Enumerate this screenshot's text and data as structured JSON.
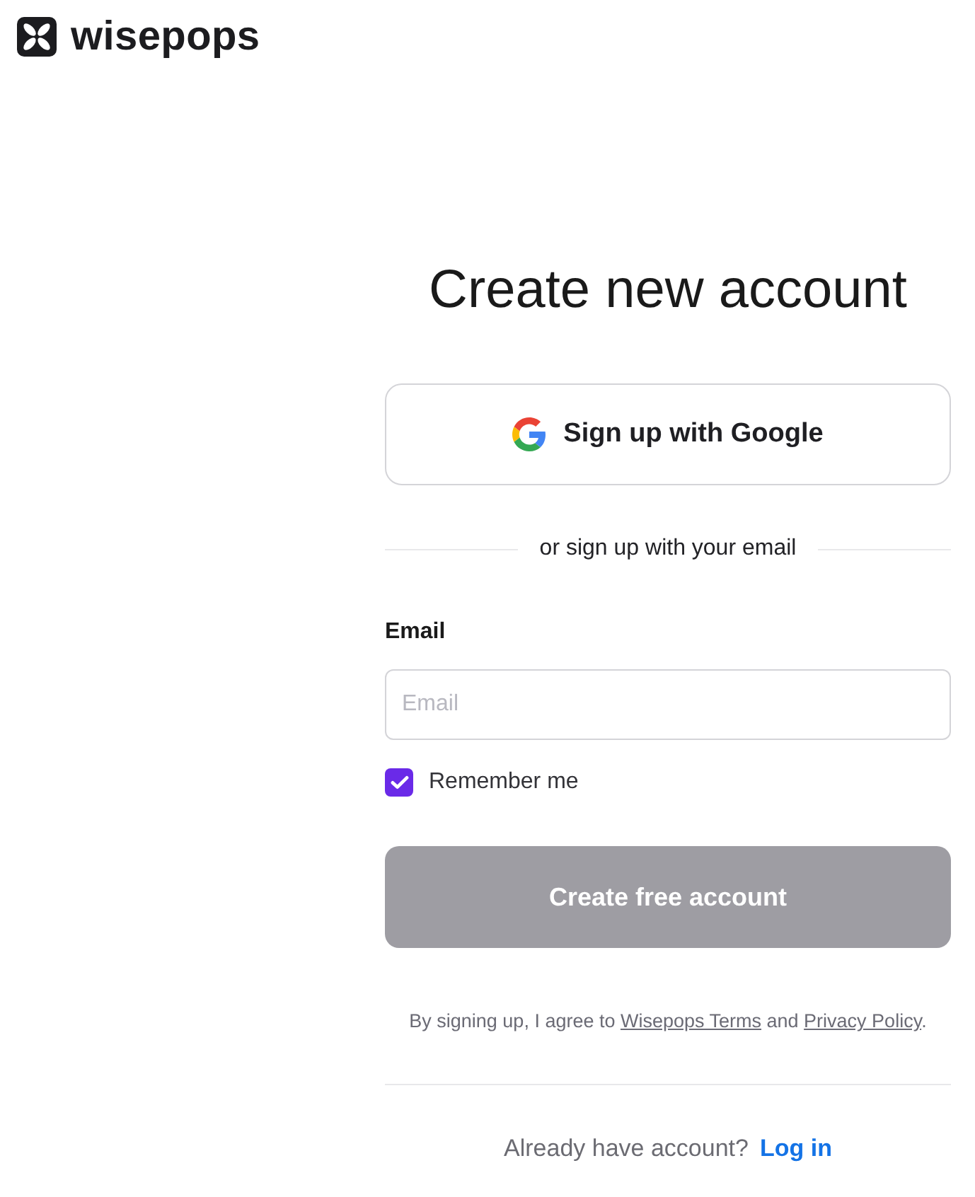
{
  "brand": {
    "name": "wisepops"
  },
  "form": {
    "title": "Create new account",
    "google_button": {
      "label": "Sign up with Google"
    },
    "divider": {
      "label": "or sign up with your email"
    },
    "email": {
      "label": "Email",
      "placeholder": "Email"
    },
    "remember": {
      "label": "Remember me",
      "checked": true
    },
    "submit": {
      "label": "Create free account",
      "disabled": true
    },
    "terms": [
      {
        "kind": "text",
        "text": "By signing up, I agree to "
      },
      {
        "kind": "link",
        "text": "Wisepops Terms"
      },
      {
        "kind": "text",
        "text": " and "
      },
      {
        "kind": "link",
        "text": "Privacy Policy"
      },
      {
        "kind": "text",
        "text": "."
      }
    ],
    "login": {
      "prompt": "Already have account?",
      "link": "Log in"
    }
  }
}
